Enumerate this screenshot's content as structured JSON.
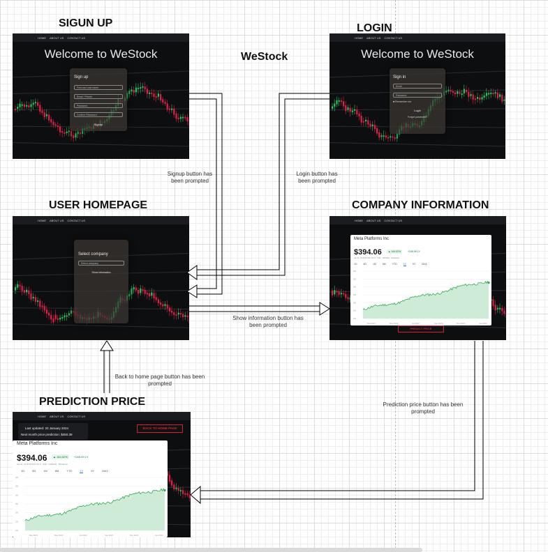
{
  "titles": {
    "signup": "SIGUN UP",
    "login": "LOGIN",
    "app": "WeStock",
    "homepage": "USER HOMEPAGE",
    "company": "COMPANY INFORMATION",
    "prediction": "PREDICTION PRICE"
  },
  "nav": [
    "HOME",
    "ABOUT US",
    "CONTACT US"
  ],
  "welcome": "Welcome to WeStock",
  "signup_form": {
    "title": "Sign up",
    "fields": [
      "First and Last name",
      "Email / Phone",
      "Password",
      "Confirm Password"
    ],
    "button": "Signup"
  },
  "login_form": {
    "title": "Sign in",
    "fields": [
      "Email",
      "Password"
    ],
    "remember": "Remember me",
    "button": "Login",
    "forgot": "Forgot password?"
  },
  "home_form": {
    "title": "Select company",
    "select_placeholder": "Select company",
    "button": "Show information"
  },
  "company": {
    "name": "Meta Platforms Inc",
    "price": "$394.06",
    "change_pct": "▲ 164.52%",
    "change_abs": "+245.09 1Y",
    "meta": "Jan 31, 10:20:33 AM UTC-5 · USD · NASDAQ · Disclaimer",
    "ranges": [
      "1D",
      "5D",
      "1M",
      "6M",
      "YTD",
      "1Y",
      "5Y",
      "MAX"
    ],
    "active_range": "1Y",
    "predict_button": "PREDICT PRICE",
    "y_ticks": [
      "400",
      "350",
      "300",
      "250",
      "200",
      "150",
      "100"
    ],
    "x_ticks": [
      "Mar 2023",
      "May 2023",
      "Jul 2023",
      "Sep 2023",
      "Nov 2023",
      "Jan 2024"
    ]
  },
  "prediction": {
    "last_updated": "Last updated: 20 January 2024",
    "next_price": "Next month price prediction: $450.39",
    "back_button": "BACK TO HOME PAGE"
  },
  "connectors": {
    "signup": "Signup button has been prompted",
    "login": "Login button has been prompted",
    "show_info": "Show information button has been prompted",
    "back_home": "Back to home page button has been prompted",
    "predict": "Prediction price button has been prompted"
  },
  "colors": {
    "chart_line": "#34a853",
    "chart_fill": "#cdebd6",
    "candle_up": "#22c55e",
    "candle_down": "#e11d48",
    "predict_red": "#d0203a"
  }
}
